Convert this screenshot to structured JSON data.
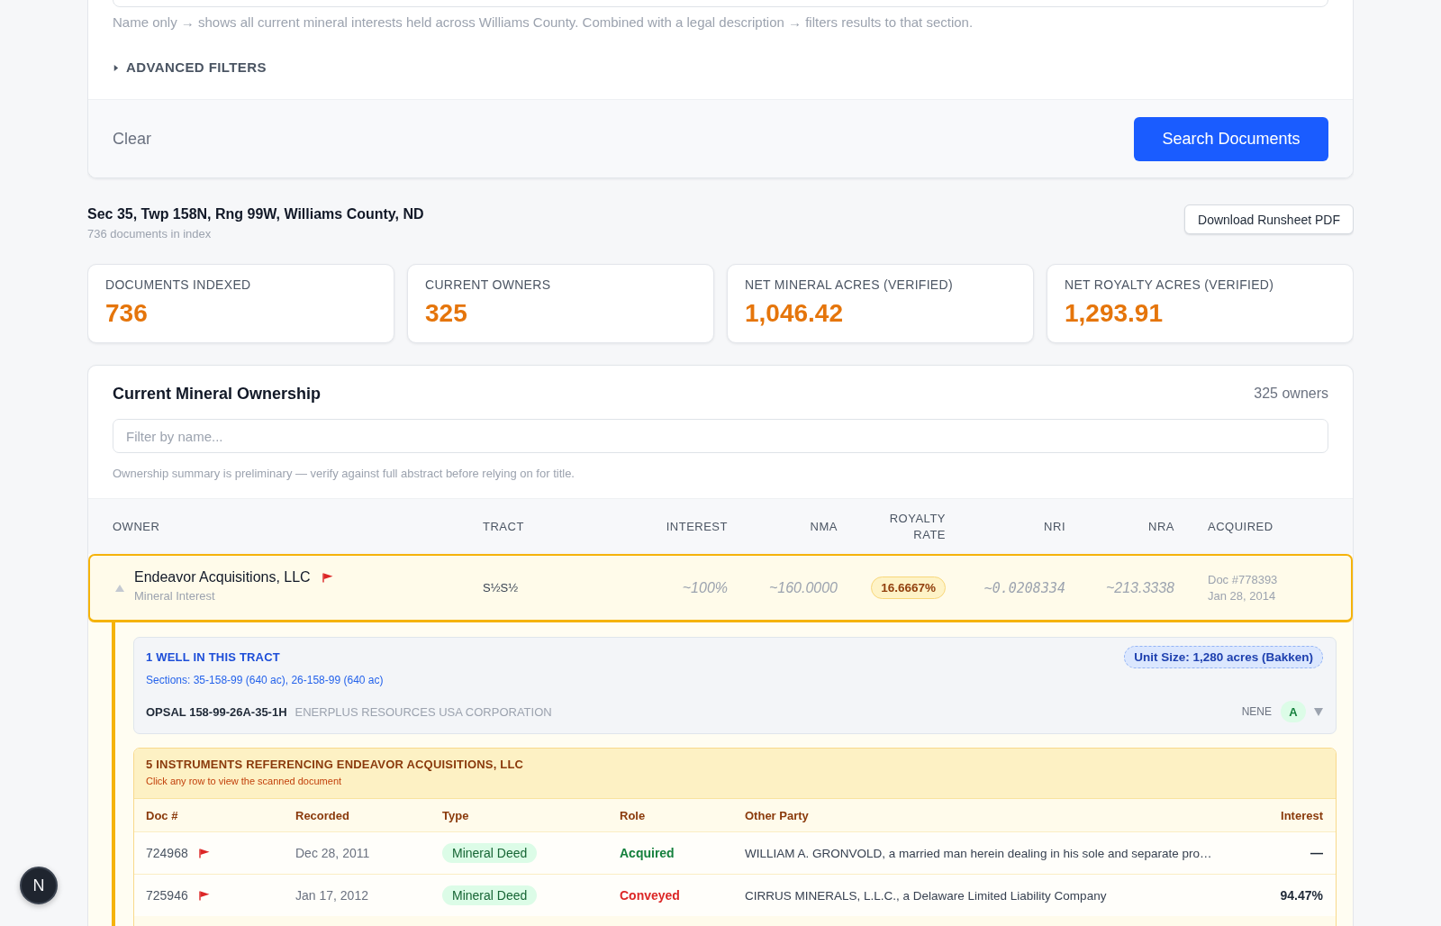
{
  "search_panel": {
    "hint": "Name only → shows all current mineral interests held across Williams County. Combined with a legal description → filters results to that section.",
    "advanced_filters": {
      "label": "ADVANCED FILTERS",
      "expanded": false
    },
    "clear_label": "Clear",
    "submit_label": "Search Documents"
  },
  "location": {
    "title": "Sec 35, Twp 158N, Rng 99W, Williams County, ND",
    "subtitle": "736 documents in index",
    "download_label": "Download Runsheet PDF"
  },
  "stats": [
    {
      "label": "DOCUMENTS INDEXED",
      "value": "736"
    },
    {
      "label": "CURRENT OWNERS",
      "value": "325"
    },
    {
      "label": "NET MINERAL ACRES (VERIFIED)",
      "value": "1,046.42"
    },
    {
      "label": "NET ROYALTY ACRES (VERIFIED)",
      "value": "1,293.91"
    }
  ],
  "ownership": {
    "title": "Current Mineral Ownership",
    "count": "325 owners",
    "filter_placeholder": "Filter by name...",
    "note": "Ownership summary is preliminary — verify against full abstract before relying on for title.",
    "columns": [
      "OWNER",
      "TRACT",
      "INTEREST",
      "NMA",
      "ROYALTY RATE",
      "NRI",
      "NRA",
      "ACQUIRED"
    ],
    "rows": [
      {
        "owner": "Endeavor Acquisitions, LLC",
        "flagged": true,
        "interest_type": "Mineral Interest",
        "tract": "S½S½",
        "interest": "~100%",
        "nma": "~160.0000",
        "royalty_rate": "16.6667%",
        "nri": "~0.0208334",
        "nra": "~213.3338",
        "acquired_doc": "Doc #778393",
        "acquired_date": "Jan 28, 2014",
        "selected": true,
        "expanded": true,
        "wells": {
          "title": "1 WELL IN THIS TRACT",
          "sections": "Sections: 35-158-99 (640 ac), 26-158-99 (640 ac)",
          "unit_size": "Unit Size: 1,280 acres (Bakken)",
          "items": [
            {
              "name": "OPSAL 158-99-26A-35-1H",
              "operator": "ENERPLUS RESOURCES USA CORPORATION",
              "location": "NENE",
              "status": "A",
              "expanded": false
            }
          ]
        },
        "instruments": {
          "title": "5 INSTRUMENTS REFERENCING ENDEAVOR ACQUISITIONS, LLC",
          "subtitle": "Click any row to view the scanned document",
          "columns": [
            "Doc #",
            "Recorded",
            "Type",
            "Role",
            "Other Party",
            "Interest"
          ],
          "rows": [
            {
              "doc": "724968",
              "flagged": true,
              "recorded": "Dec 28, 2011",
              "type": "Mineral Deed",
              "role": "Acquired",
              "outgoing": false,
              "other_party": "WILLIAM A. GRONVOLD, a married man herein dealing in his sole and separate pro…",
              "interest": "—"
            },
            {
              "doc": "725946",
              "flagged": true,
              "recorded": "Jan 17, 2012",
              "type": "Mineral Deed",
              "role": "Conveyed",
              "outgoing": true,
              "other_party": "CIRRUS MINERALS, L.L.C., a Delaware Limited Liability Company",
              "interest": "94.47%"
            }
          ]
        }
      }
    ]
  },
  "dev_badge": {
    "label": "N"
  }
}
